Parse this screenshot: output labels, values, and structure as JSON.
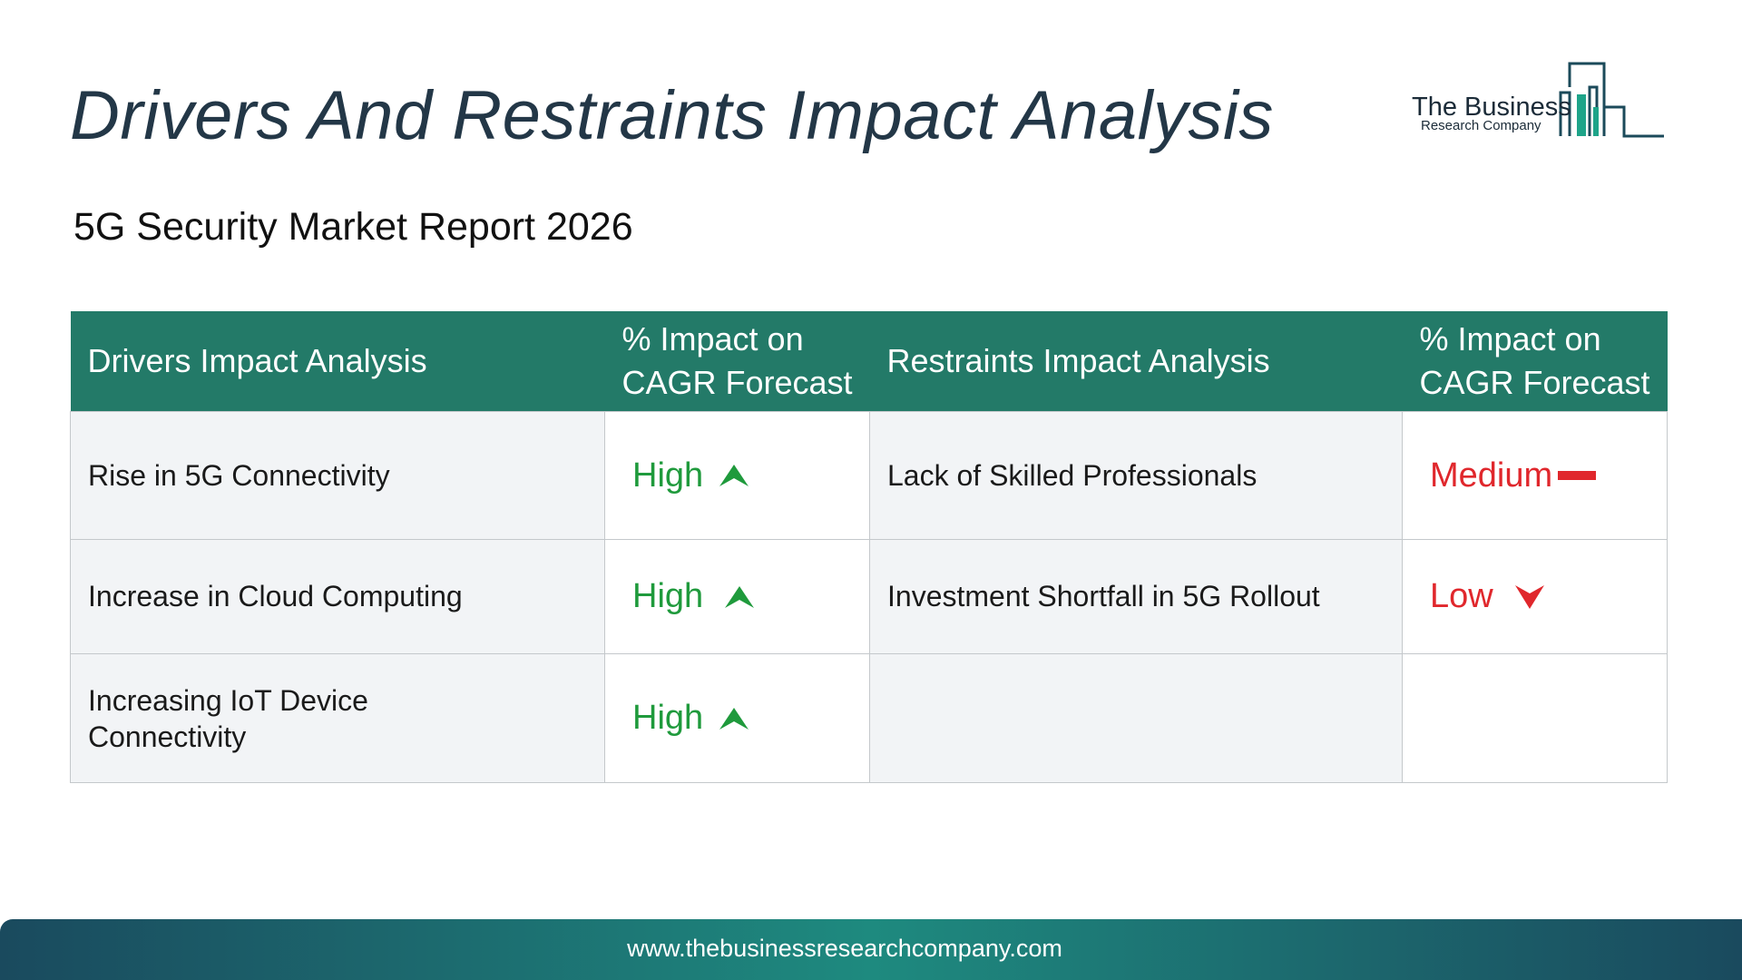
{
  "title": "Drivers And Restraints Impact Analysis",
  "subtitle": "5G Security Market Report 2026",
  "logo": {
    "name": "The Business",
    "sub": "Research Company"
  },
  "table": {
    "headers": [
      "Drivers Impact Analysis",
      "% Impact on CAGR Forecast",
      "Restraints Impact Analysis",
      "% Impact on CAGR Forecast"
    ],
    "rows": [
      {
        "driver": "Rise in 5G Connectivity",
        "driver_impact": "High",
        "driver_icon": "arrow-up-icon",
        "restraint": "Lack of Skilled Professionals",
        "restraint_impact": "Medium",
        "restraint_icon": "dash-icon"
      },
      {
        "driver": "Increase in Cloud Computing",
        "driver_impact": "High",
        "driver_icon": "arrow-up-icon",
        "restraint": "Investment Shortfall in 5G Rollout",
        "restraint_impact": "Low",
        "restraint_icon": "arrow-down-icon"
      },
      {
        "driver": "Increasing IoT Device Connectivity",
        "driver_impact": "High",
        "driver_icon": "arrow-up-icon",
        "restraint": "",
        "restraint_impact": "",
        "restraint_icon": ""
      }
    ]
  },
  "colors": {
    "header_bg": "#237a68",
    "high": "#1f9a3c",
    "low": "#e0272c",
    "title": "#233747"
  },
  "footer": {
    "url": "www.thebusinessresearchcompany.com"
  }
}
